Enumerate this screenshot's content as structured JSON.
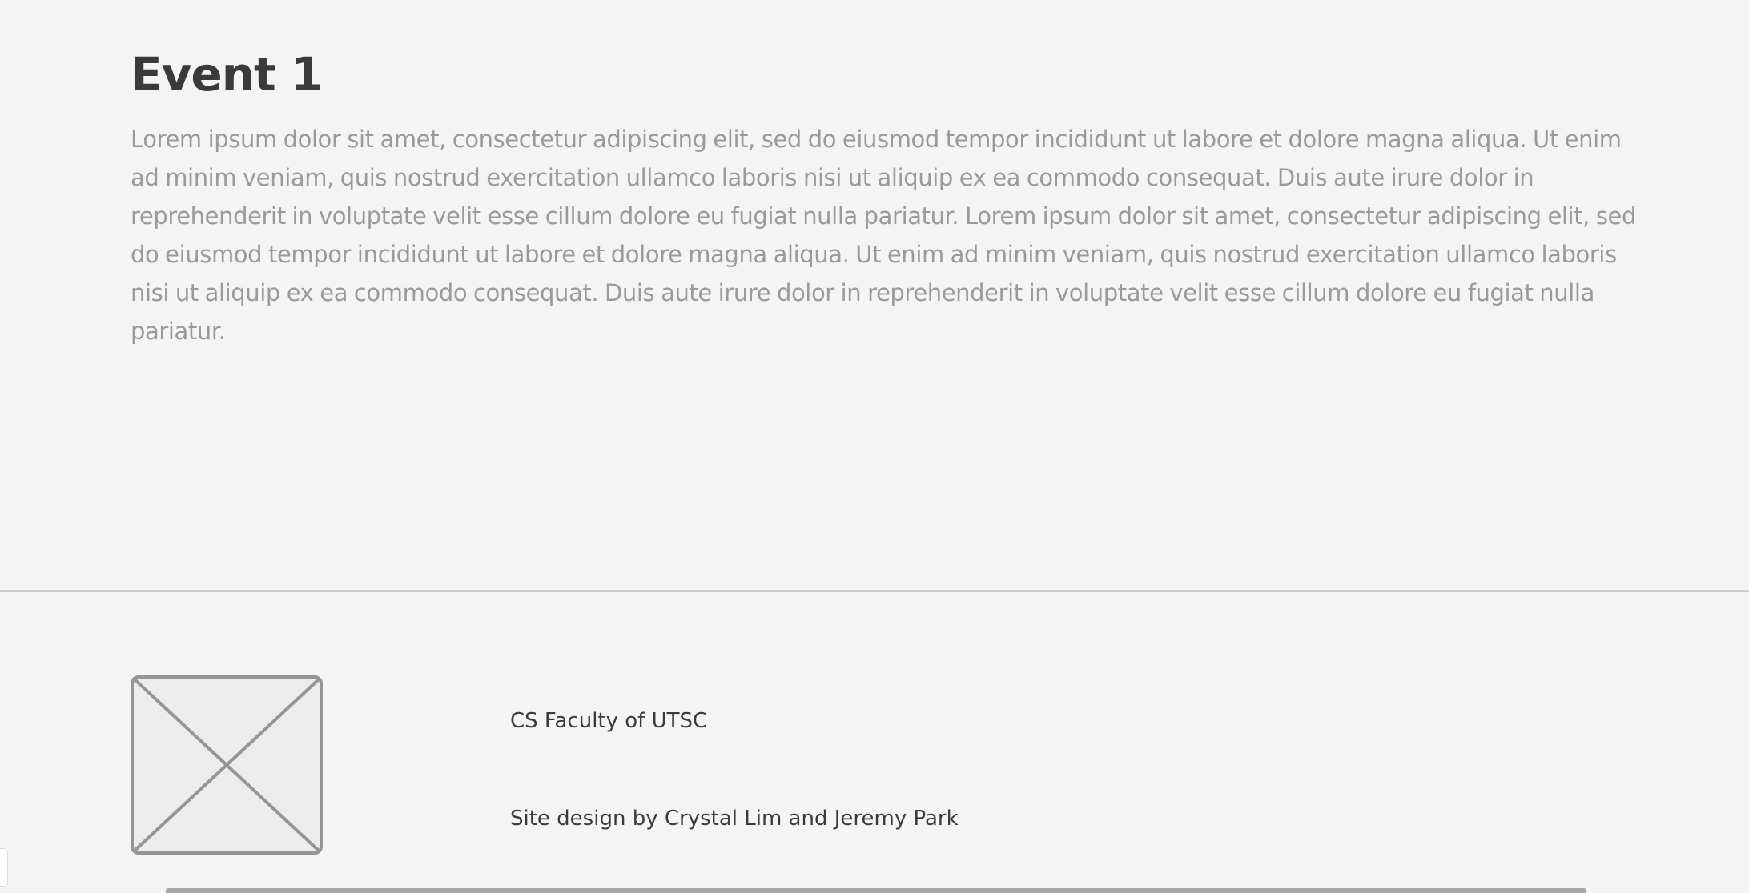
{
  "event": {
    "title": "Event 1",
    "body": "Lorem ipsum dolor sit amet, consectetur adipiscing elit, sed do eiusmod tempor incididunt ut labore et dolore magna aliqua. Ut enim ad minim veniam, quis nostrud exercitation ullamco laboris nisi ut aliquip ex ea commodo consequat. Duis aute irure dolor in reprehenderit in voluptate velit esse cillum dolore eu fugiat nulla pariatur. Lorem ipsum dolor sit amet, consectetur adipiscing elit, sed do eiusmod tempor incididunt ut labore et dolore magna aliqua. Ut enim ad minim veniam, quis nostrud exercitation ullamco laboris nisi ut aliquip ex ea commodo consequat. Duis aute irure dolor in reprehenderit in voluptate velit esse cillum dolore eu fugiat nulla pariatur."
  },
  "footer": {
    "organization": "CS Faculty of UTSC",
    "credit": "Site design by Crystal Lim and Jeremy Park",
    "image_icon": "image-placeholder-icon"
  },
  "colors": {
    "background": "#f4f4f4",
    "heading": "#3a3a3a",
    "body_text": "#9a9a9a",
    "divider": "#cccccc",
    "placeholder_stroke": "#959595",
    "placeholder_fill": "#ececec"
  }
}
